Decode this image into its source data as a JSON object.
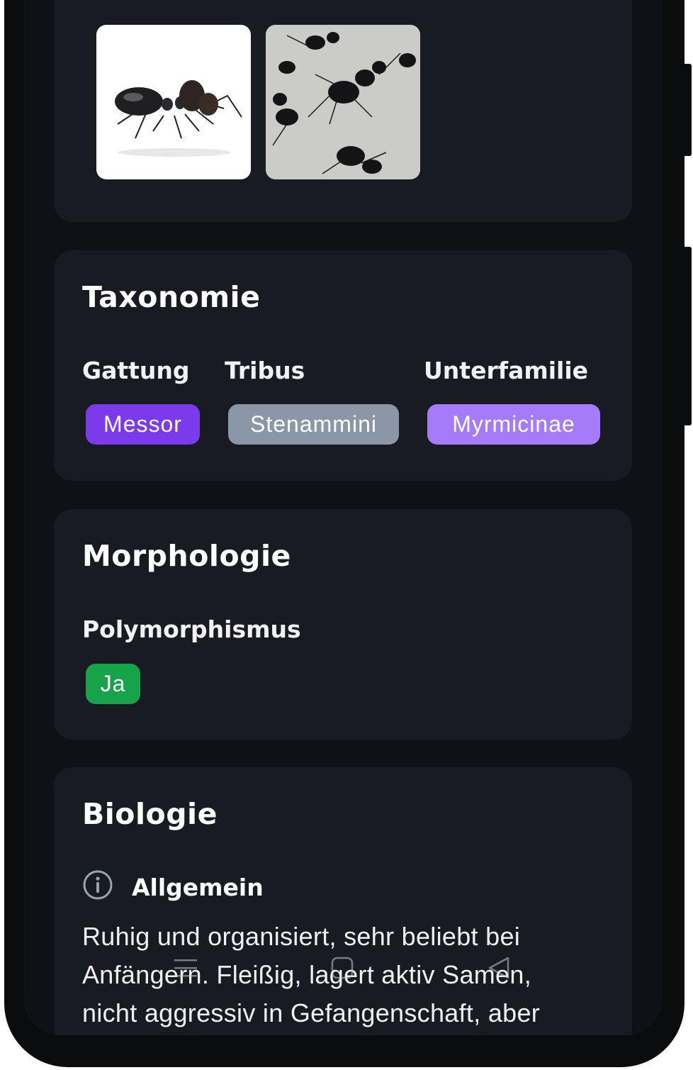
{
  "gallery": {
    "images": [
      {
        "alt": "Einzelne Ameise auf weißem Hintergrund"
      },
      {
        "alt": "Gruppe von Ameisen auf Stein"
      }
    ]
  },
  "taxonomy": {
    "title": "Taxonomie",
    "fields": [
      {
        "label": "Gattung",
        "value": "Messor",
        "color": "#7c3aed"
      },
      {
        "label": "Tribus",
        "value": "Stenammini",
        "color": "#8b96a6"
      },
      {
        "label": "Unterfamilie",
        "value": "Myrmicinae",
        "color": "#a67bfa"
      }
    ]
  },
  "morphology": {
    "title": "Morphologie",
    "polymorphism_label": "Polymorphismus",
    "polymorphism_value": "Ja",
    "polymorphism_color": "#16a34a"
  },
  "biology": {
    "title": "Biologie",
    "general_icon": "info-icon",
    "general_label": "Allgemein",
    "general_lines": [
      "Ruhig und organisiert, sehr beliebt bei",
      "Anfängern. Fleißig, lagert aktiv Samen,",
      "nicht aggressiv in Gefangenschaft, aber"
    ]
  },
  "navbar": {
    "icons": [
      "menu-icon",
      "home-icon",
      "back-icon"
    ]
  }
}
